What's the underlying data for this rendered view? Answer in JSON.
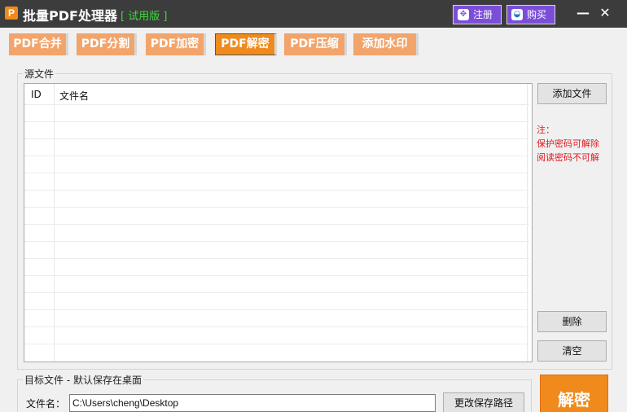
{
  "window": {
    "title": "批量PDF处理器",
    "trial_label": "[ 试用版 ]",
    "register_label": "注册",
    "buy_label": "购买",
    "minimize_glyph": "—",
    "close_glyph": "✕"
  },
  "tabs": [
    {
      "label": "PDF合并"
    },
    {
      "label": "PDF分割"
    },
    {
      "label": "PDF加密"
    },
    {
      "label": "PDF解密",
      "active": true
    },
    {
      "label": "PDF压缩"
    },
    {
      "label": "添加水印"
    }
  ],
  "source_group": {
    "label": "源文件",
    "columns": {
      "id": "ID",
      "name": "文件名"
    },
    "rows": []
  },
  "side_buttons": {
    "add_file": "添加文件",
    "delete": "删除",
    "clear": "清空"
  },
  "note": {
    "heading": "注：",
    "line1": "保护密码可解除",
    "line2": "阅读密码不可解"
  },
  "target_group": {
    "label": "目标文件 - 默认保存在桌面",
    "filename_label": "文件名：",
    "path_value": "C:\\Users\\cheng\\Desktop",
    "change_path_label": "更改保存路径"
  },
  "action": {
    "label": "解密"
  },
  "colors": {
    "accent": "#f08a1c",
    "tab_inactive": "#f2a46b",
    "titlebar": "#3c3c3c",
    "purple_button": "#7b4ed9",
    "note_red": "#e0191f",
    "trial_green": "#3fd93f"
  }
}
